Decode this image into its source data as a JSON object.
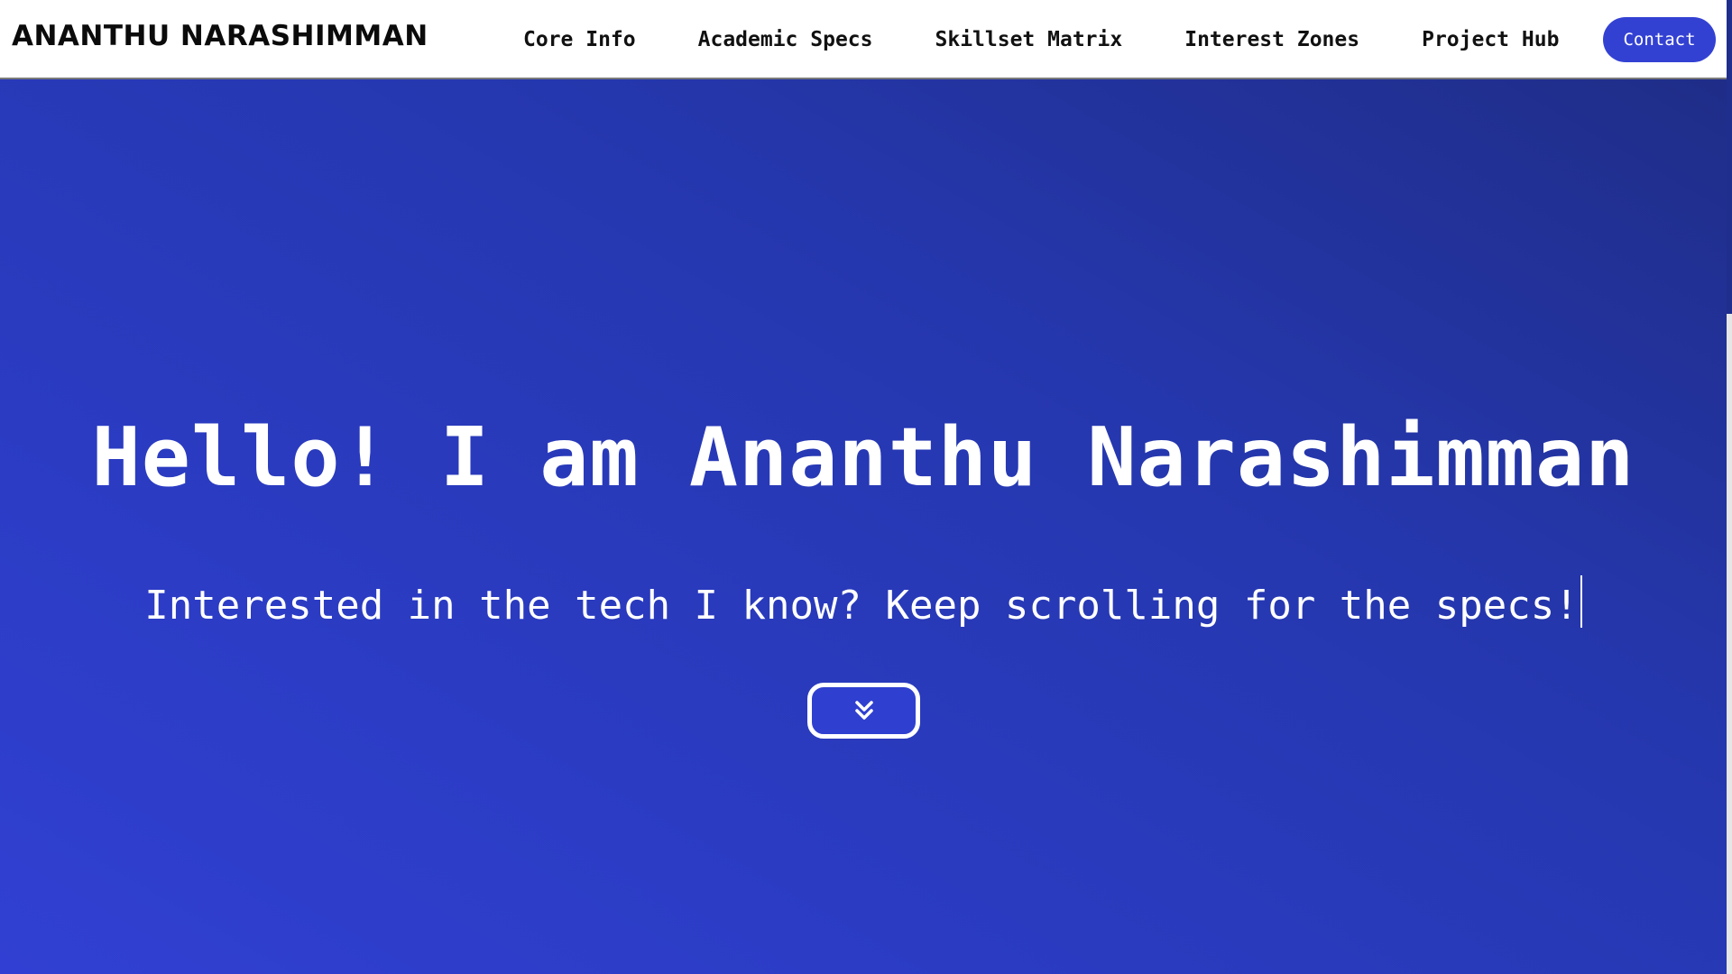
{
  "header": {
    "brand": "ANANTHU NARASHIMMAN",
    "nav": [
      {
        "label": "Core Info"
      },
      {
        "label": "Academic Specs"
      },
      {
        "label": "Skillset Matrix"
      },
      {
        "label": "Interest Zones"
      },
      {
        "label": "Project Hub"
      }
    ],
    "contact_label": "Contact"
  },
  "hero": {
    "headline": "Hello! I am Ananthu Narashimman",
    "subline": "Interested in the tech I know? Keep scrolling for the specs!",
    "scroll_icon": "double-chevron-down-icon"
  },
  "colors": {
    "accent": "#3341d3",
    "hero_start": "#3140d2",
    "hero_end": "#1f2d88",
    "nav_bg": "#ffffff"
  }
}
